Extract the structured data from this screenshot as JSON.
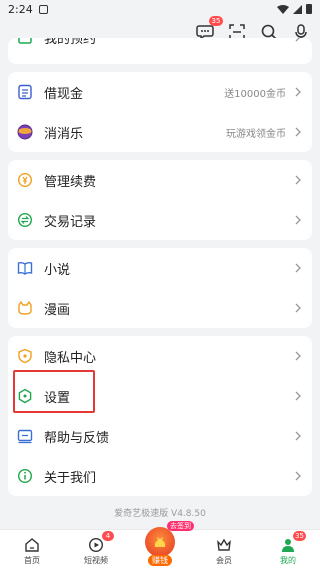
{
  "status_bar": {
    "time": "2:24"
  },
  "top_badge": "35",
  "groups": [
    {
      "items": [
        {
          "label": "我的预约",
          "right": ""
        }
      ]
    },
    {
      "items": [
        {
          "label": "借现金",
          "right": "送10000金币"
        },
        {
          "label": "消消乐",
          "right": "玩游戏领金币"
        }
      ]
    },
    {
      "items": [
        {
          "label": "管理续费",
          "right": ""
        },
        {
          "label": "交易记录",
          "right": ""
        }
      ]
    },
    {
      "items": [
        {
          "label": "小说",
          "right": ""
        },
        {
          "label": "漫画",
          "right": ""
        }
      ]
    },
    {
      "items": [
        {
          "label": "隐私中心",
          "right": ""
        },
        {
          "label": "设置",
          "right": ""
        },
        {
          "label": "帮助与反馈",
          "right": ""
        },
        {
          "label": "关于我们",
          "right": ""
        }
      ]
    }
  ],
  "version": "爱奇艺极速版 V4.8.50",
  "tabbar": {
    "tabs": [
      {
        "label": "首页"
      },
      {
        "label": "短视频",
        "badge": "4"
      },
      {
        "label": "赚钱",
        "tag": "去签到"
      },
      {
        "label": "会员"
      },
      {
        "label": "我的",
        "badge": "35"
      }
    ]
  },
  "colors": {
    "accent": "#1fa84f",
    "badge": "#ff4d4f",
    "highlight": "#e53935"
  }
}
